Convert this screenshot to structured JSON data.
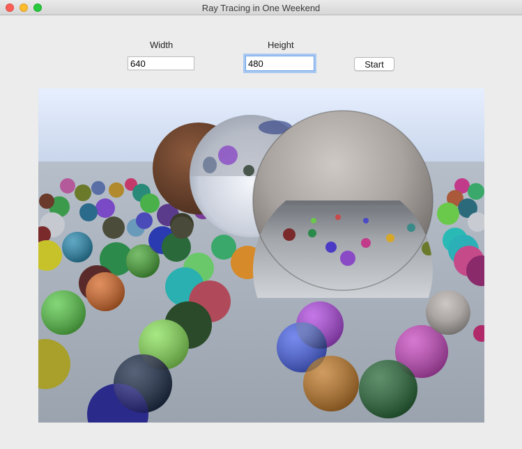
{
  "window": {
    "title": "Ray Tracing in One Weekend"
  },
  "form": {
    "width_label": "Width",
    "width_value": "640",
    "height_label": "Height",
    "height_value": "480",
    "start_label": "Start"
  },
  "render": {
    "sky_top": "#e6efff",
    "sky_bottom": "#c6d4ea",
    "ground": "#a7afba"
  }
}
